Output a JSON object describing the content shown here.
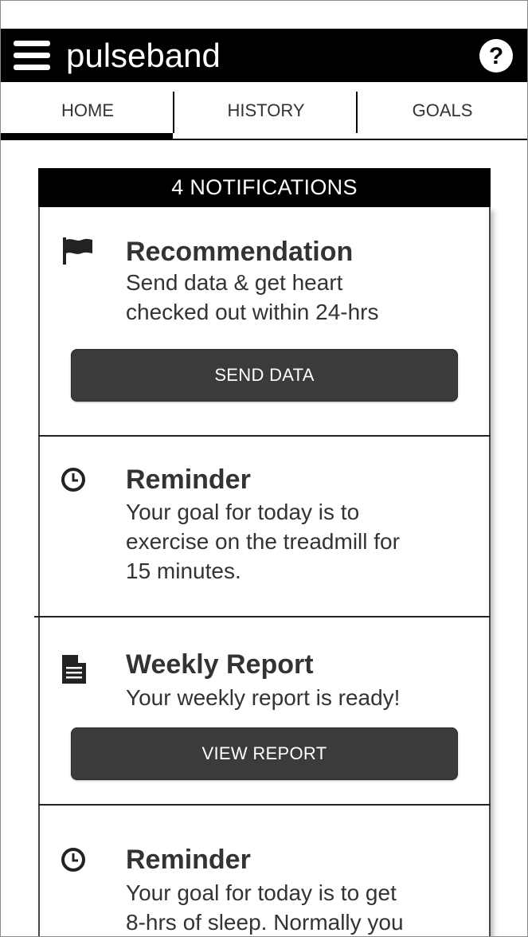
{
  "app": {
    "title": "pulseband"
  },
  "icons": {
    "menu": "hamburger-menu-icon",
    "help": "question-circle-icon",
    "recommendation": "flag-icon",
    "reminder": "clock-icon",
    "report": "document-icon"
  },
  "tabs": [
    {
      "label": "HOME",
      "active": true
    },
    {
      "label": "HISTORY",
      "active": false
    },
    {
      "label": "GOALS",
      "active": false
    }
  ],
  "notifications": {
    "header": "4 NOTIFICATIONS",
    "items": [
      {
        "title": "Recommendation",
        "lines": [
          "Send data & get heart",
          "checked out within 24-hrs"
        ],
        "action": "SEND DATA"
      },
      {
        "title": "Reminder",
        "lines": [
          "Your goal for today is to",
          "exercise on the treadmill for",
          "15 minutes."
        ]
      },
      {
        "title": "Weekly Report",
        "lines": [
          "Your weekly report is ready!"
        ],
        "action": "VIEW REPORT"
      },
      {
        "title": "Reminder",
        "lines": [
          "Your goal for today is to get",
          "8-hrs of sleep. Normally you"
        ]
      }
    ]
  },
  "colors": {
    "bar": "#000000",
    "button": "#3b3b3b",
    "text": "#333333",
    "background": "#ffffff"
  }
}
